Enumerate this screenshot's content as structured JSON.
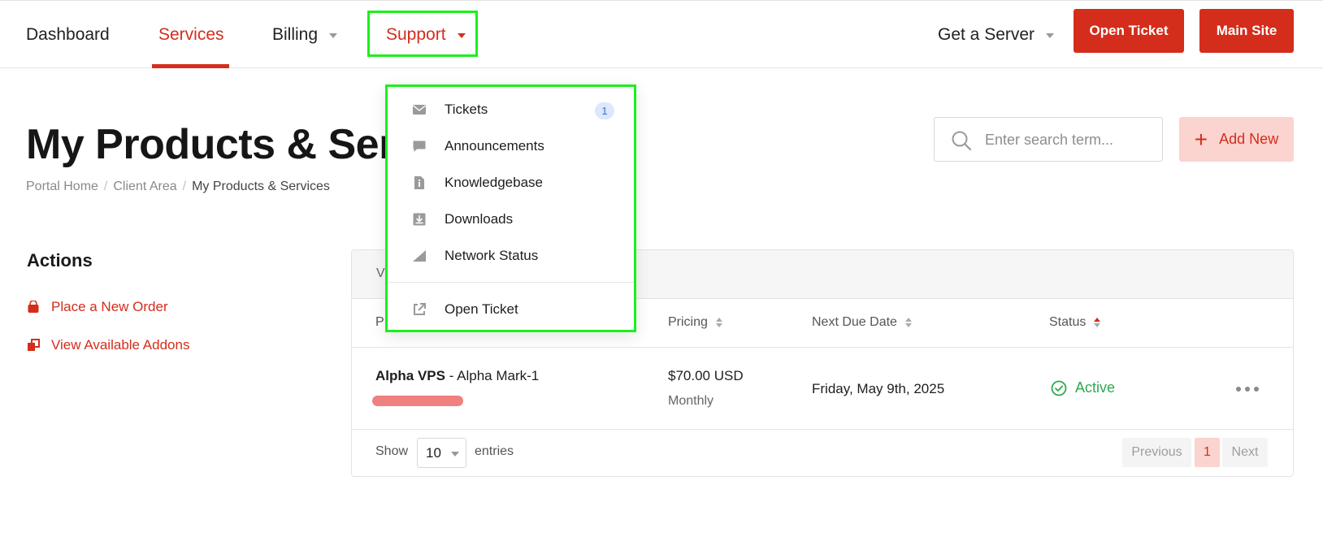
{
  "nav": {
    "items": [
      "Dashboard",
      "Services",
      "Billing",
      "Support"
    ],
    "get_server": "Get a Server",
    "open_ticket_btn": "Open Ticket",
    "main_site_btn": "Main Site"
  },
  "support_menu": {
    "items": [
      {
        "label": "Tickets",
        "icon": "envelope-icon",
        "badge": "1"
      },
      {
        "label": "Announcements",
        "icon": "comment-icon"
      },
      {
        "label": "Knowledgebase",
        "icon": "document-info-icon"
      },
      {
        "label": "Downloads",
        "icon": "download-icon"
      },
      {
        "label": "Network Status",
        "icon": "signal-icon"
      },
      {
        "label": "Open Ticket",
        "icon": "external-link-icon"
      }
    ]
  },
  "page": {
    "title": "My Products & Services",
    "breadcrumb": [
      "Portal Home",
      "Client Area",
      "My Products & Services"
    ]
  },
  "search": {
    "placeholder": "Enter search term..."
  },
  "add_new": {
    "label": "Add New"
  },
  "actions": {
    "title": "Actions",
    "items": [
      {
        "label": "Place a New Order",
        "icon": "shopping-bag-icon"
      },
      {
        "label": "View Available Addons",
        "icon": "addons-icon"
      }
    ]
  },
  "table": {
    "head_text": "V",
    "columns": [
      "P",
      "Pricing",
      "Next Due Date",
      "Status"
    ],
    "rows": [
      {
        "product": "Alpha VPS",
        "plan": "- Alpha Mark-1",
        "price": "$70.00 USD",
        "cycle": "Monthly",
        "due": "Friday, May 9th, 2025",
        "status": "Active"
      }
    ],
    "show": "Show",
    "entries": "entries",
    "page_size": "10",
    "pagination": {
      "previous": "Previous",
      "current": "1",
      "next": "Next"
    }
  },
  "colors": {
    "accent": "#d42d1b",
    "highlight": "#1cf01c",
    "status_active": "#2fa84f",
    "add_new_bg": "#fbd3cf"
  }
}
